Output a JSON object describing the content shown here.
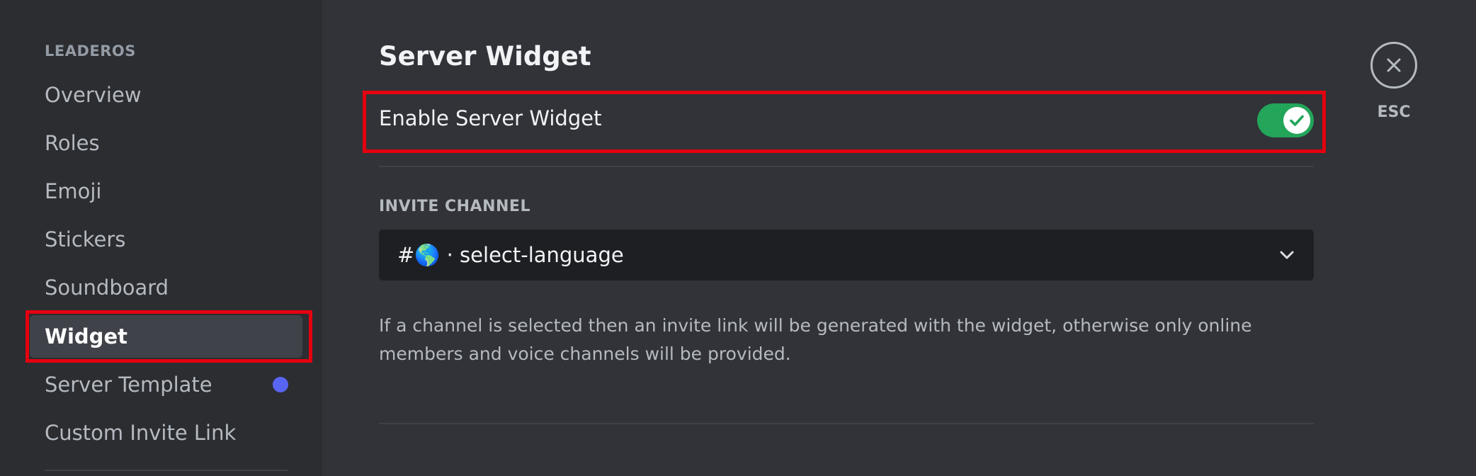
{
  "sidebar": {
    "heading": "LEADEROS",
    "items": [
      {
        "label": "Overview"
      },
      {
        "label": "Roles"
      },
      {
        "label": "Emoji"
      },
      {
        "label": "Stickers"
      },
      {
        "label": "Soundboard"
      },
      {
        "label": "Widget",
        "active": true
      },
      {
        "label": "Server Template",
        "badge_color": "#5865f2"
      },
      {
        "label": "Custom Invite Link"
      }
    ]
  },
  "main": {
    "title": "Server Widget",
    "enable_label": "Enable Server Widget",
    "enable_toggle_on": true,
    "invite_channel_label": "INVITE CHANNEL",
    "invite_channel_value": "#🌎 · select-language",
    "help_text": "If a channel is selected then an invite link will be generated with the widget, otherwise only online members and voice channels will be provided."
  },
  "close": {
    "label": "ESC",
    "icon": "close-icon"
  },
  "colors": {
    "highlight": "#e4000f",
    "toggle_on": "#23a55a",
    "accent": "#5865f2"
  }
}
